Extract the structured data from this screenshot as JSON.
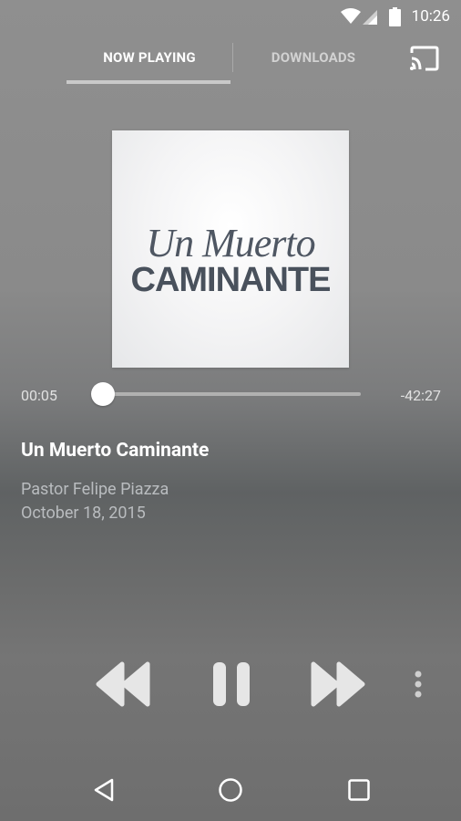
{
  "status_bar": {
    "time": "10:26"
  },
  "tabs": [
    {
      "label": "NOW PLAYING",
      "active": true
    },
    {
      "label": "DOWNLOADS",
      "active": false
    }
  ],
  "album_art": {
    "script_text": "Un Muerto",
    "bold_text": "CAMINANTE"
  },
  "player": {
    "elapsed": "00:05",
    "remaining": "-42:27",
    "progress": 0.002
  },
  "track": {
    "title": "Un Muerto Caminante",
    "artist": "Pastor Felipe Piazza",
    "date": "October 18, 2015"
  },
  "icons": {
    "wifi": "wifi-icon",
    "signal": "signal-icon",
    "battery": "battery-icon",
    "cast": "cast-icon",
    "rewind": "rewind-icon",
    "pause": "pause-icon",
    "forward": "fast-forward-icon",
    "more": "more-vert-icon",
    "back": "nav-back-icon",
    "home": "nav-home-icon",
    "recents": "nav-recents-icon"
  },
  "colors": {
    "background_top": "#8f8f8f",
    "background_mid": "#5f6263",
    "accent": "#ffffff"
  }
}
